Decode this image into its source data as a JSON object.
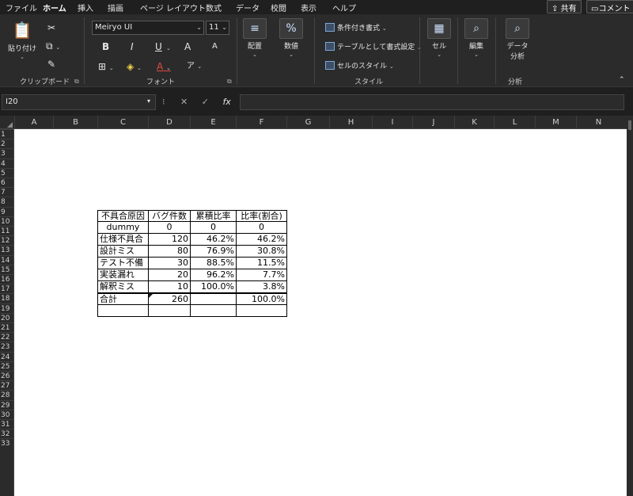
{
  "tabs": [
    "ファイル",
    "ホーム",
    "挿入",
    "描画",
    "ページ レイアウト",
    "数式",
    "データ",
    "校閲",
    "表示",
    "ヘルプ"
  ],
  "active_tab": "ホーム",
  "share_label": "共有",
  "comment_label": "コメント",
  "clipboard": {
    "paste_label": "貼り付け",
    "group_label": "クリップボード"
  },
  "font": {
    "name": "Meiryo UI",
    "size": "11",
    "group_label": "フォント",
    "bold": "B",
    "italic": "I",
    "underline": "U",
    "grow": "A",
    "shrink": "A",
    "font_color_glyph": "A",
    "phonetic_glyph": "ア"
  },
  "alignment": {
    "label": "配置"
  },
  "number": {
    "label": "数値"
  },
  "styles": {
    "conditional": "条件付き書式",
    "table": "テーブルとして書式設定",
    "cell_styles": "セルのスタイル",
    "group_label": "スタイル"
  },
  "cells": {
    "label": "セル"
  },
  "editing": {
    "label": "編集"
  },
  "analysis": {
    "label_line1": "データ",
    "label_line2": "分析",
    "group_label": "分析"
  },
  "formula_bar": {
    "name_box": "I20",
    "cancel": "✕",
    "enter": "✓",
    "fx": "fx",
    "value": ""
  },
  "columns": [
    "A",
    "B",
    "C",
    "D",
    "E",
    "F",
    "G",
    "H",
    "I",
    "J",
    "K",
    "L",
    "M",
    "N"
  ],
  "rows": [
    "1",
    "2",
    "3",
    "4",
    "5",
    "6",
    "7",
    "8",
    "9",
    "10",
    "11",
    "12",
    "13",
    "14",
    "15",
    "16",
    "17",
    "18",
    "19",
    "20",
    "21",
    "22",
    "23",
    "24",
    "25",
    "26",
    "27",
    "28",
    "29",
    "30",
    "31",
    "32",
    "33"
  ],
  "table": {
    "headers": [
      "不具合原因",
      "バグ件数",
      "累積比率",
      "比率(割合)"
    ],
    "rows": [
      [
        "dummy",
        "0",
        "0",
        "0"
      ],
      [
        "仕様不具合",
        "120",
        "46.2%",
        "46.2%"
      ],
      [
        "設計ミス",
        "80",
        "76.9%",
        "30.8%"
      ],
      [
        "テスト不備",
        "30",
        "88.5%",
        "11.5%"
      ],
      [
        "実装漏れ",
        "20",
        "96.2%",
        "7.7%"
      ],
      [
        "解釈ミス",
        "10",
        "100.0%",
        "3.8%"
      ],
      [
        "合計",
        "260",
        "",
        "100.0%"
      ],
      [
        "",
        "",
        "",
        ""
      ]
    ]
  }
}
